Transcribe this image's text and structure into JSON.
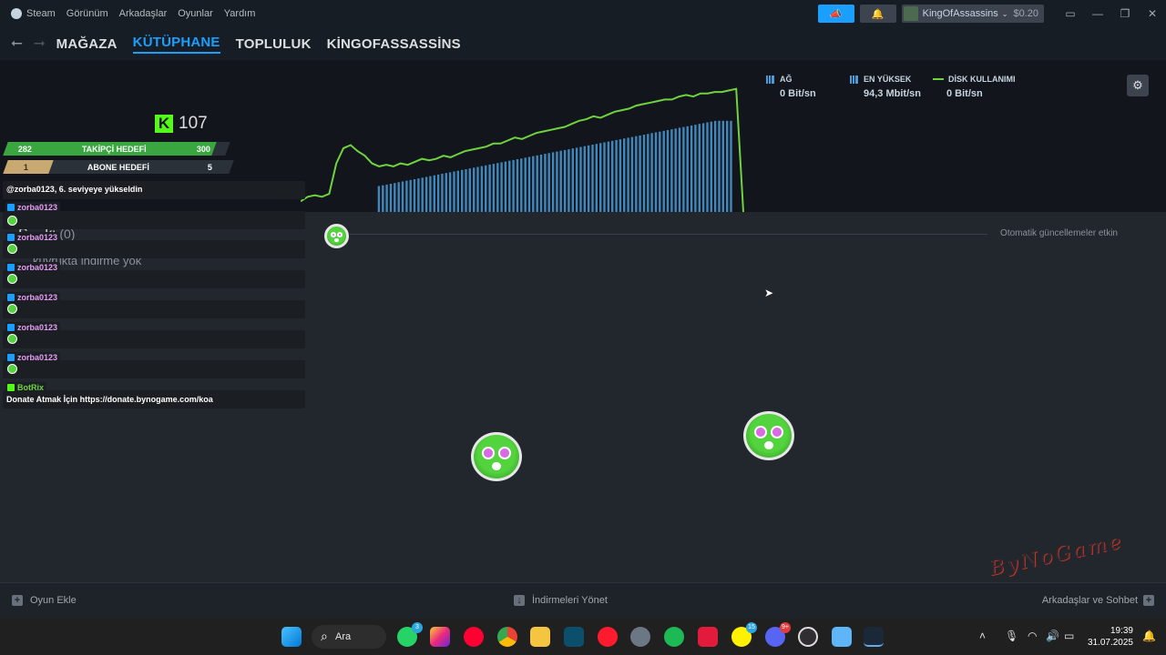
{
  "menu": [
    "Steam",
    "Görünüm",
    "Arkadaşlar",
    "Oyunlar",
    "Yardım"
  ],
  "account": {
    "name": "KingOfAssassins",
    "balance": "$0.20"
  },
  "nav": {
    "links": [
      "MAĞAZA",
      "KÜTÜPHANE",
      "TOPLULUK",
      "KİNGOFASSASSİNS"
    ],
    "active": "KÜTÜPHANE"
  },
  "stats": {
    "network": {
      "label": "AĞ",
      "value": "0 Bit/sn"
    },
    "peak": {
      "label": "EN YÜKSEK",
      "value": "94,3 Mbit/sn"
    },
    "disk": {
      "label": "DİSK KULLANIMI",
      "value": "0 Bit/sn"
    }
  },
  "queue": {
    "title_a": "S",
    "title_b": "ki",
    "count": "(0)",
    "empty_text": "kuyrukta indirme yok",
    "auto_updates": "Otomatik güncellemeler etkin"
  },
  "overlay": {
    "kick_followers": "107",
    "follow_goal": {
      "current": "282",
      "label": "TAKİPÇİ HEDEFİ",
      "target": "300",
      "progress": 0.94
    },
    "sub_goal": {
      "current": "1",
      "label": "ABONE HEDEFİ",
      "target": "5",
      "progress": 0.2
    },
    "levelup": "@zorba0123, 6. seviyeye yükseldin",
    "chat_user": "zorba0123",
    "bot_name": "BotRix",
    "bot_msg": "Donate Atmak İçin https://donate.bynogame.com/koa",
    "watermark": "ByNoGame"
  },
  "bottom": {
    "add_game": "Oyun Ekle",
    "manage": "İndirmeleri Yönet",
    "friends": "Arkadaşlar ve Sohbet"
  },
  "taskbar": {
    "search": "Ara",
    "time": "19:39",
    "date": "31.07.2025",
    "badge_whatsapp": "3",
    "badge_15": "15",
    "badge_discord": "9+"
  },
  "colors": {
    "accent": "#1a9fff",
    "graph_line": "#6fd23f",
    "graph_bars": "#4b9bd6",
    "kick": "#53fc18"
  },
  "graph": {
    "bars": [
      0,
      0,
      0,
      0,
      0,
      0,
      0,
      0,
      0,
      0,
      0,
      0,
      0,
      0,
      0,
      0,
      0,
      0,
      0,
      0,
      0,
      0,
      0,
      0,
      0,
      0,
      0,
      0,
      0,
      0,
      0,
      0,
      0,
      0,
      0,
      0,
      0,
      0,
      0,
      0,
      0,
      0,
      0,
      0,
      0,
      0,
      0,
      0,
      0,
      0,
      0,
      0,
      0,
      0,
      0,
      0,
      0,
      0,
      0,
      0,
      0,
      0,
      0,
      0,
      0,
      0,
      0,
      0,
      0,
      0,
      0,
      0,
      0,
      0,
      0,
      0,
      0,
      0,
      0,
      0,
      0,
      0,
      0,
      0,
      0,
      0,
      0,
      0,
      0,
      0,
      0,
      0,
      0,
      0,
      0,
      0,
      0,
      0,
      0,
      0,
      0,
      0,
      0,
      0,
      0,
      0
    ],
    "line": [
      0.07,
      0.1,
      0.11,
      0.1,
      0.12,
      0.32,
      0.42,
      0.44,
      0.4,
      0.37,
      0.32,
      0.3,
      0.31,
      0.3,
      0.32,
      0.31,
      0.33,
      0.35,
      0.34,
      0.35,
      0.37,
      0.36,
      0.38,
      0.4,
      0.41,
      0.42,
      0.43,
      0.45,
      0.45,
      0.47,
      0.49,
      0.48,
      0.5,
      0.52,
      0.53,
      0.54,
      0.55,
      0.56,
      0.58,
      0.6,
      0.61,
      0.63,
      0.62,
      0.64,
      0.66,
      0.67,
      0.68,
      0.7,
      0.71,
      0.72,
      0.73,
      0.74,
      0.74,
      0.76,
      0.77,
      0.76,
      0.78,
      0.78,
      0.79,
      0.79,
      0.8,
      0.81,
      0.0
    ]
  }
}
